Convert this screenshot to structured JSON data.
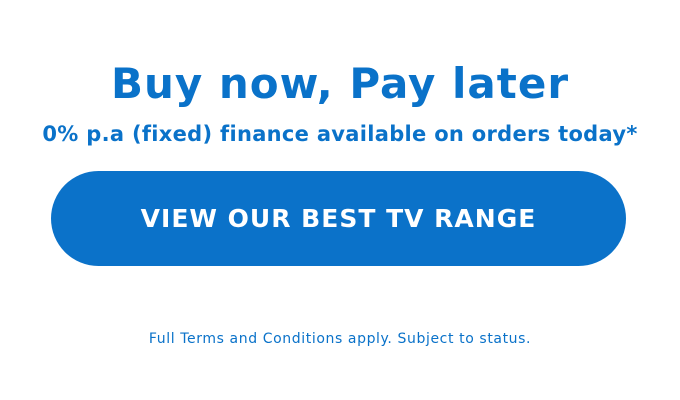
{
  "banner": {
    "headline": "Buy now, Pay later",
    "subline": "0% p.a (fixed) finance available on orders today*",
    "cta_label": "VIEW OUR BEST TV RANGE",
    "terms": "Full Terms and Conditions apply. Subject to status."
  },
  "colors": {
    "brand_blue": "#0a72c9",
    "button_text": "#ffffff",
    "background": "#ffffff"
  }
}
